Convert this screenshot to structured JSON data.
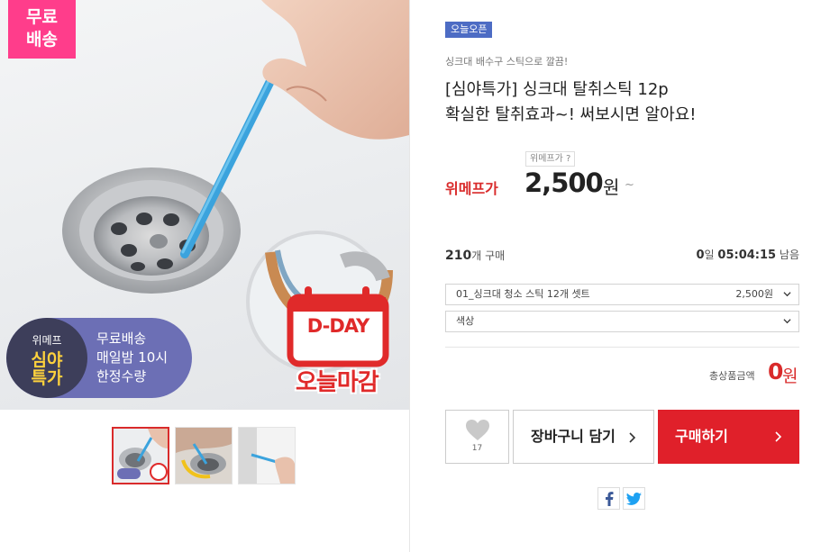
{
  "hero": {
    "free_badge": "무료\n배송",
    "free_badge_line1": "무료",
    "free_badge_line2": "배송",
    "promo_brand": "위메프",
    "promo_title": "심야\n특가",
    "promo_title_line1": "심야",
    "promo_title_line2": "특가",
    "promo_lines": [
      "무료배송",
      "매일밤 10시",
      "한정수량"
    ],
    "dday_label": "D-DAY",
    "deadline_label": "오늘마감"
  },
  "thumbnails": [
    {
      "name": "thumb-1",
      "active": true
    },
    {
      "name": "thumb-2",
      "active": false
    },
    {
      "name": "thumb-3",
      "active": false
    }
  ],
  "product": {
    "tag": "오늘오픈",
    "subtitle": "싱크대 배수구 스틱으로 깔끔!",
    "title_line1": "[심야특가] 싱크대 탈취스틱 12p",
    "title_line2": "확실한 탈취효과~! 써보시면 알아요!",
    "price_info_label": "위메프가 ?",
    "price_label": "위메프가",
    "price": "2,500",
    "price_unit": "원",
    "price_tilde": "~",
    "sold_count": "210",
    "sold_suffix": "개 구매",
    "timer_days": "0",
    "timer_day_suffix": "일",
    "timer_time": "05:04:15",
    "timer_suffix": "남음"
  },
  "options": {
    "option1_label": "01_싱크대 청소 스틱 12개 셋트",
    "option1_price": "2,500원",
    "option2_label": "색상"
  },
  "total": {
    "label": "총상품금액",
    "value": "0",
    "unit": "원"
  },
  "actions": {
    "wish_count": "17",
    "cart_label": "장바구니 담기",
    "buy_label": "구매하기"
  },
  "share": {
    "facebook_icon": "facebook-icon",
    "twitter_icon": "twitter-icon"
  },
  "colors": {
    "accent_red": "#e0202a",
    "tag_blue": "#4d6cc4",
    "badge_pink": "#ff3d8b",
    "promo_purple": "#6c6fb5"
  }
}
